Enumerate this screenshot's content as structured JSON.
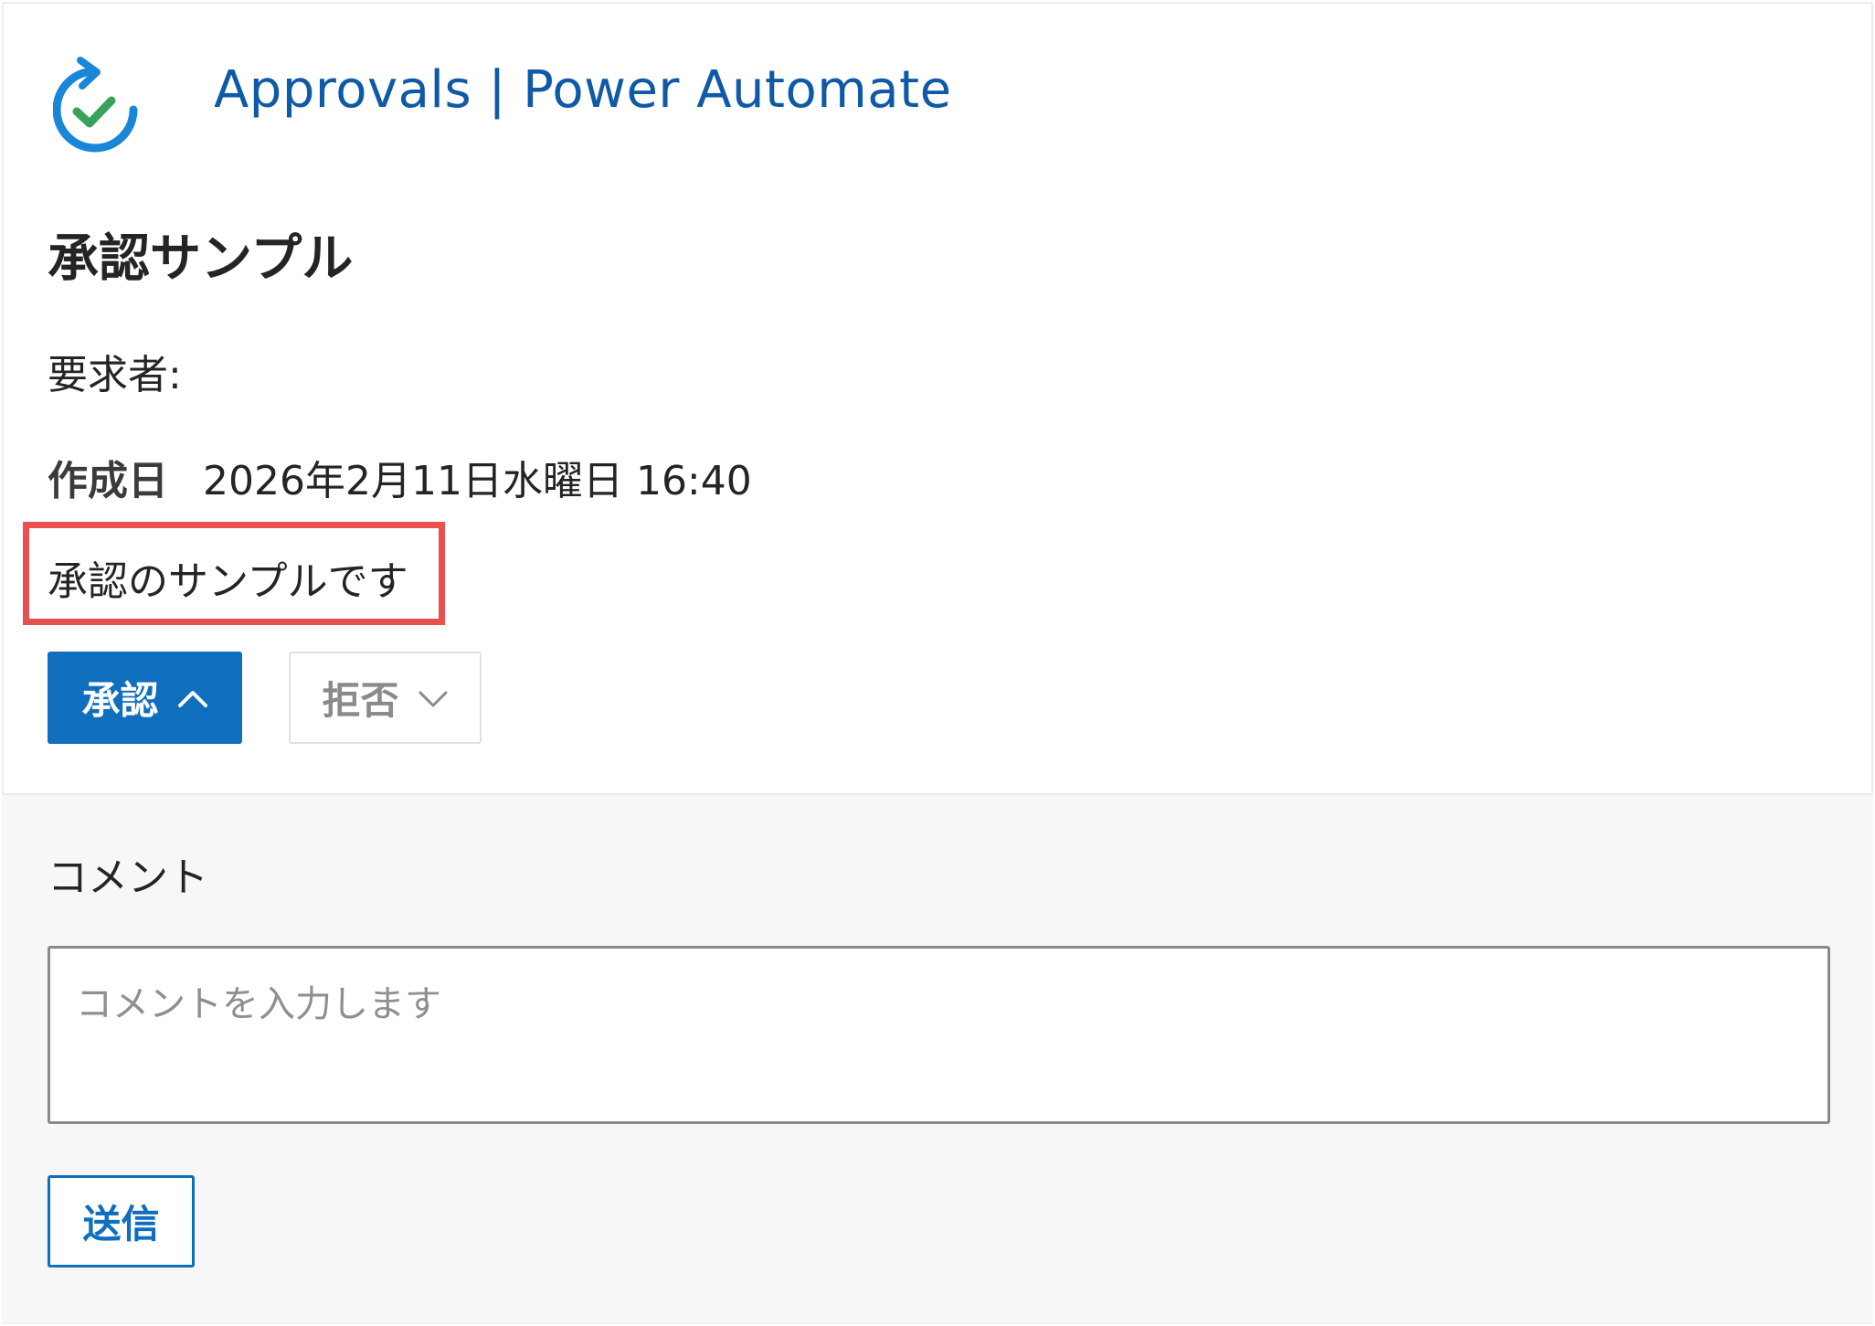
{
  "header": {
    "app_title": "Approvals | Power Automate",
    "icon": "approvals-refresh-check-icon"
  },
  "approval": {
    "title": "承認サンプル",
    "requester_label": "要求者:",
    "requester_value": "",
    "created_label": "作成日",
    "created_value": "2026年2月11日水曜日 16:40",
    "description": "承認のサンプルです"
  },
  "actions": {
    "approve_label": "承認",
    "approve_icon": "chevron-up-icon",
    "reject_label": "拒否",
    "reject_icon": "chevron-down-icon"
  },
  "comment": {
    "label": "コメント",
    "placeholder": "コメントを入力します",
    "value": "",
    "send_label": "送信"
  },
  "colors": {
    "primary": "#106ebe",
    "title_blue": "#0f5aa6",
    "highlight_red": "#e8514f",
    "check_green": "#3aa35b",
    "section_bg": "#f7f7f7"
  }
}
